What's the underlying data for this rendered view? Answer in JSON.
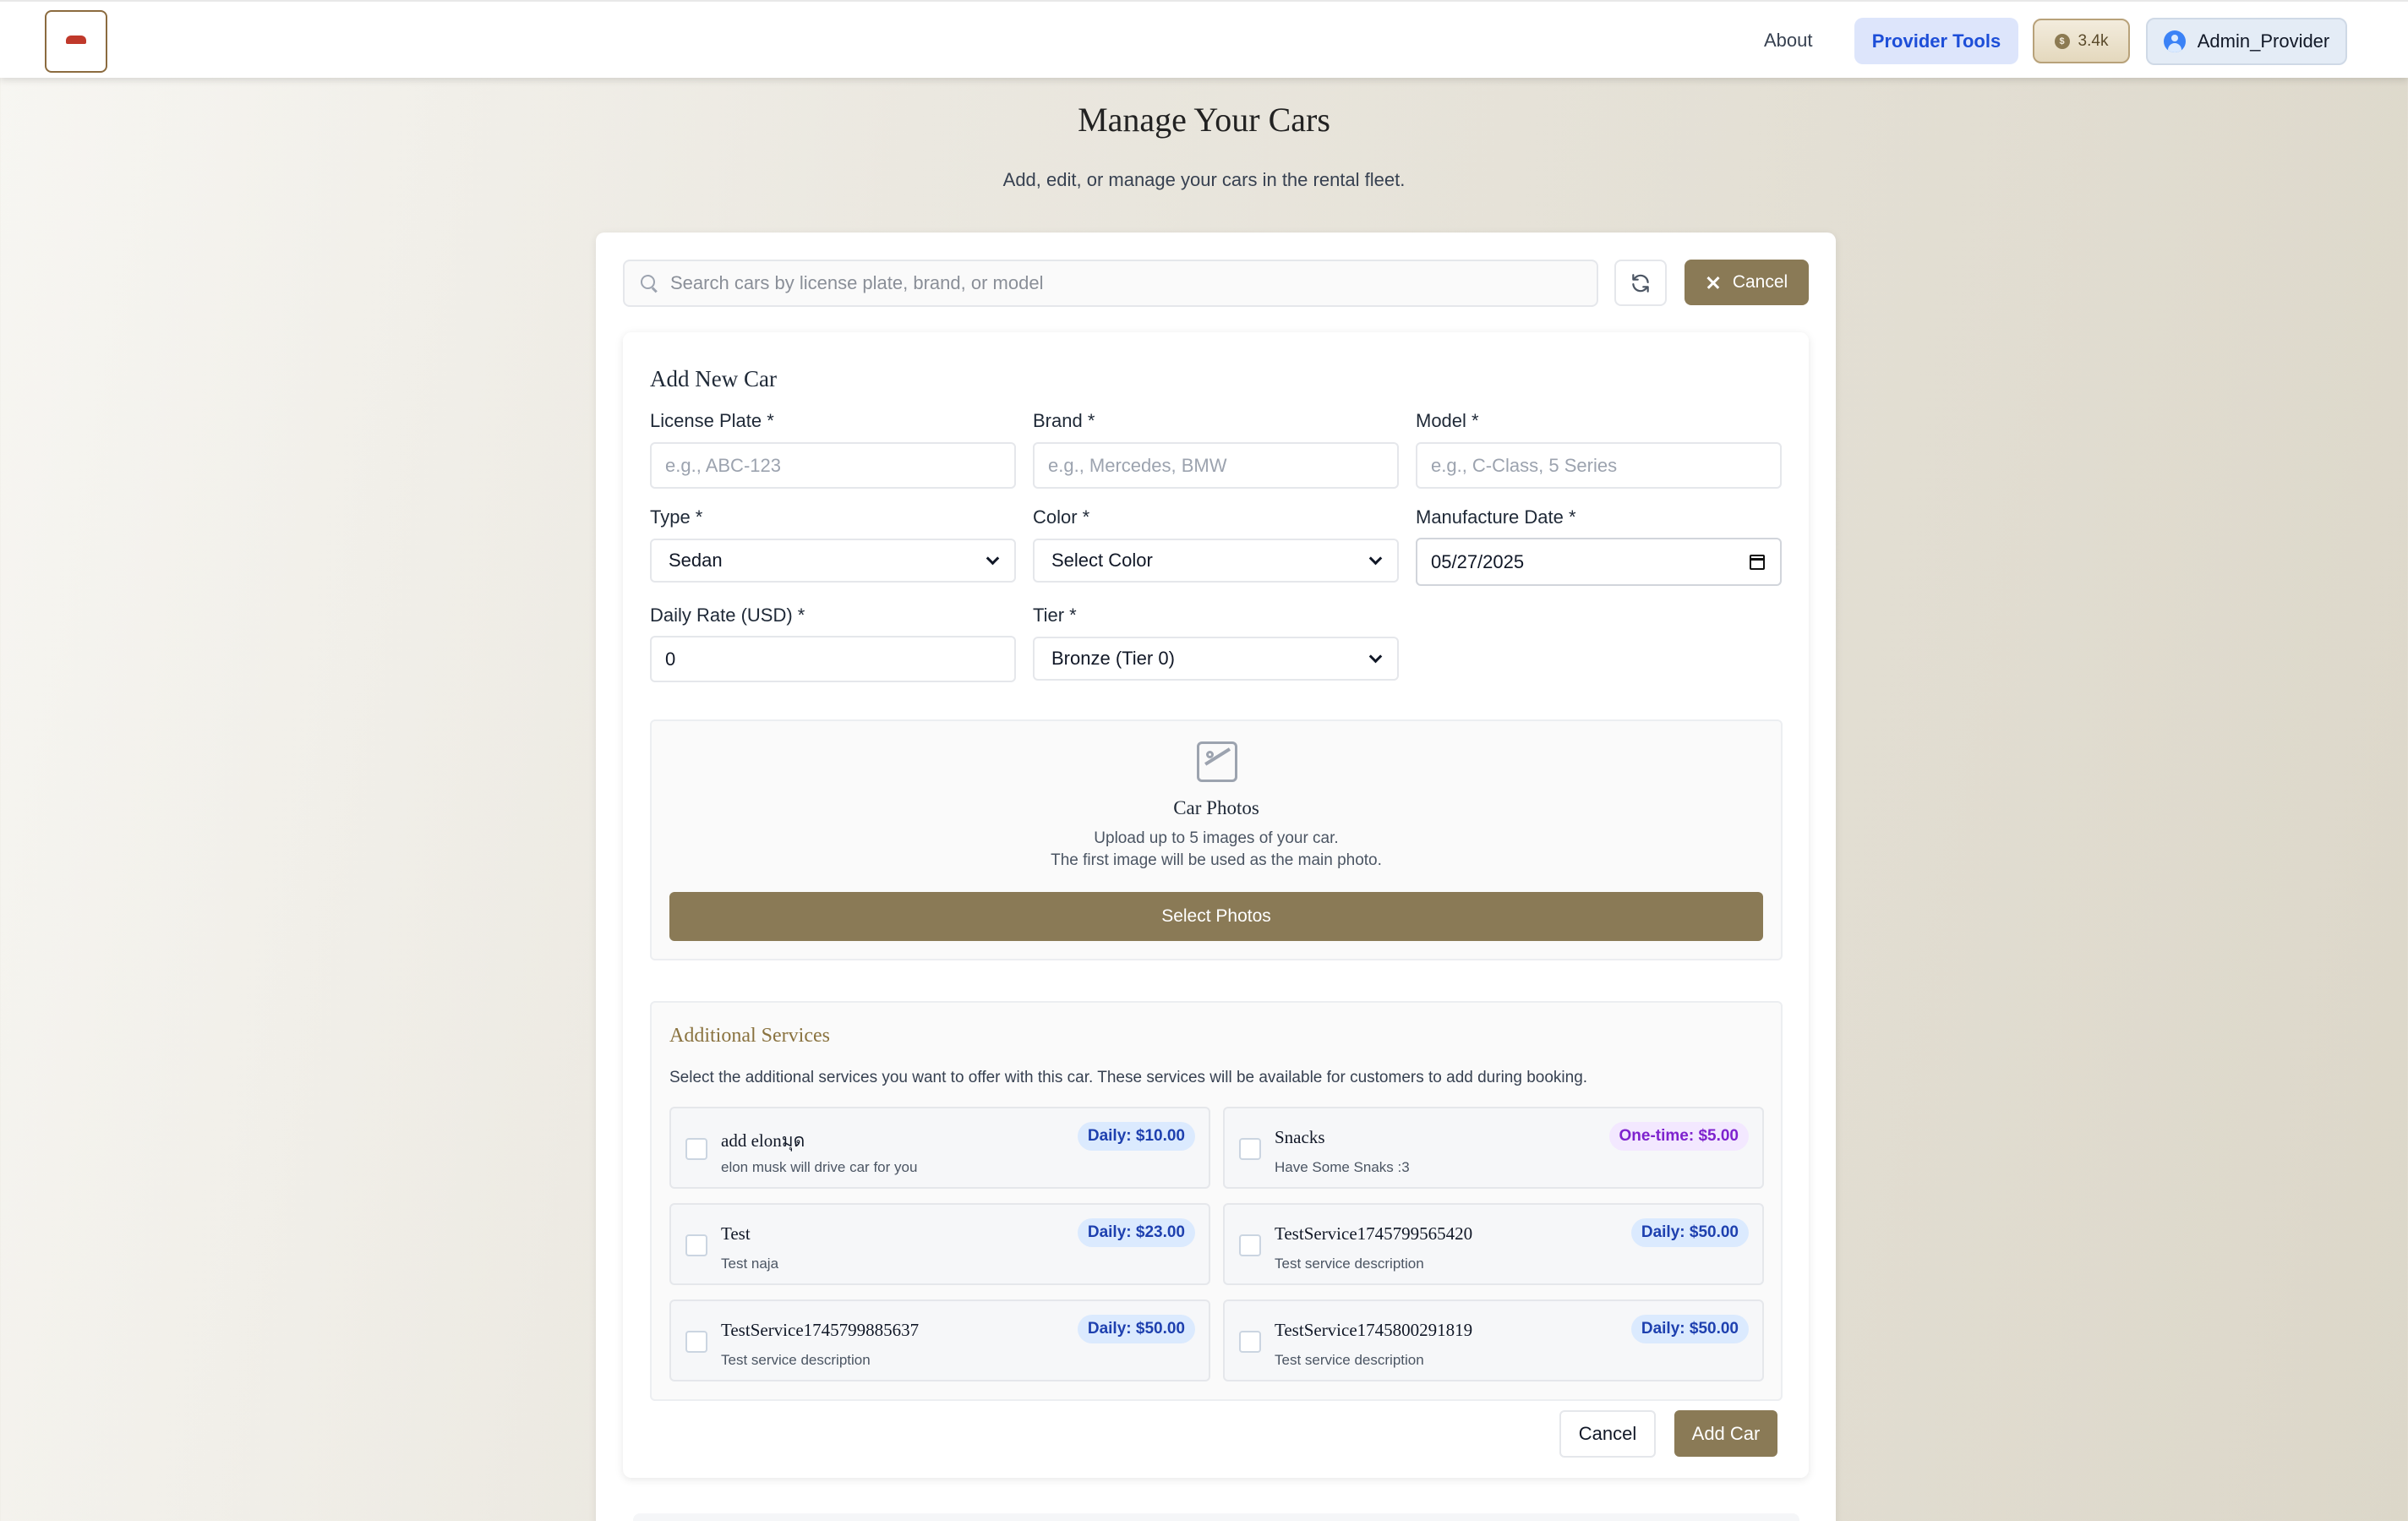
{
  "header": {
    "nav_about": "About",
    "nav_provider_tools": "Provider Tools",
    "coins": "3.4k",
    "username": "Admin_Provider"
  },
  "page": {
    "title": "Manage Your Cars",
    "subtitle": "Add, edit, or manage your cars in the rental fleet."
  },
  "toolbar": {
    "search_placeholder": "Search cars by license plate, brand, or model",
    "search_value": "",
    "cancel_label": "Cancel"
  },
  "form": {
    "title": "Add New Car",
    "license_plate": {
      "label": "License Plate *",
      "placeholder": "e.g., ABC-123",
      "value": ""
    },
    "brand": {
      "label": "Brand *",
      "placeholder": "e.g., Mercedes, BMW",
      "value": ""
    },
    "model": {
      "label": "Model *",
      "placeholder": "e.g., C-Class, 5 Series",
      "value": ""
    },
    "type": {
      "label": "Type *",
      "selected": "Sedan"
    },
    "color": {
      "label": "Color *",
      "selected": "Select Color"
    },
    "manufacture_date": {
      "label": "Manufacture Date *",
      "value": "05/27/2025"
    },
    "daily_rate": {
      "label": "Daily Rate (USD) *",
      "value": "0"
    },
    "tier": {
      "label": "Tier *",
      "selected": "Bronze (Tier 0)"
    },
    "photos": {
      "title": "Car Photos",
      "desc_line1": "Upload up to 5 images of your car.",
      "desc_line2": "The first image will be used as the main photo.",
      "button": "Select Photos"
    },
    "services": {
      "title": "Additional Services",
      "description": "Select the additional services you want to offer with this car. These services will be available for customers to add during booking.",
      "items": [
        {
          "name": "add elonมุด",
          "desc": "elon musk will drive car for you",
          "price": "Daily: $10.00",
          "kind": "daily"
        },
        {
          "name": "Snacks",
          "desc": "Have Some Snaks :3",
          "price": "One-time: $5.00",
          "kind": "onetime"
        },
        {
          "name": "Test",
          "desc": "Test naja",
          "price": "Daily: $23.00",
          "kind": "daily"
        },
        {
          "name": "TestService1745799565420",
          "desc": "Test service description",
          "price": "Daily: $50.00",
          "kind": "daily"
        },
        {
          "name": "TestService1745799885637",
          "desc": "Test service description",
          "price": "Daily: $50.00",
          "kind": "daily"
        },
        {
          "name": "TestService1745800291819",
          "desc": "Test service description",
          "price": "Daily: $50.00",
          "kind": "daily"
        }
      ]
    },
    "cancel_label": "Cancel",
    "submit_label": "Add Car"
  },
  "colors": {
    "accent": "#8a7a56",
    "provider_tools_bg": "#dde5fb",
    "provider_tools_text": "#1d4ed8",
    "services_title": "#8a7340",
    "daily_badge_bg": "#dbeafe",
    "daily_badge_text": "#1e40af",
    "onetime_badge_bg": "#f3e8ff",
    "onetime_badge_text": "#7e22ce"
  },
  "icons": [
    "logo",
    "coin-icon",
    "user-icon",
    "search-icon",
    "refresh-icon",
    "close-icon",
    "chevron-down-icon",
    "calendar-icon",
    "image-icon",
    "checkbox"
  ]
}
